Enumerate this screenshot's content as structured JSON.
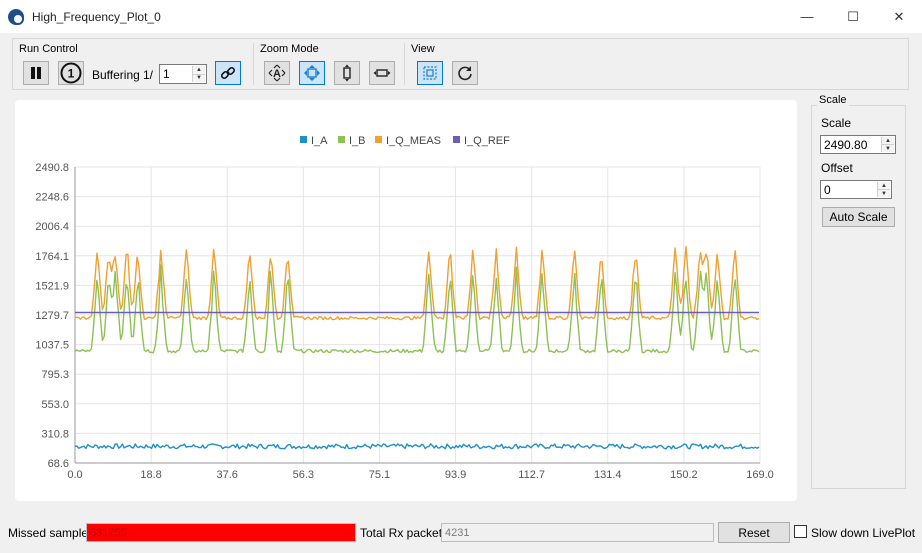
{
  "window": {
    "title": "High_Frequency_Plot_0",
    "minimize_glyph": "—",
    "maximize_glyph": "☐",
    "close_glyph": "✕"
  },
  "toolbar": {
    "run_control": {
      "title": "Run Control",
      "pause_icon": "pause-icon",
      "single_icon": "single-step-icon",
      "single_glyph": "1",
      "buffering_label": "Buffering",
      "buffering_prefix": "1/",
      "buffering_value": "1",
      "link_icon": "link-icon"
    },
    "zoom_mode": {
      "title": "Zoom Mode",
      "icons": [
        "zoom-all-icon",
        "zoom-xy-icon",
        "zoom-vertical-icon",
        "zoom-horizontal-icon"
      ]
    },
    "view": {
      "title": "View",
      "icons": [
        "fit-view-icon",
        "refresh-icon"
      ]
    }
  },
  "chart_data": {
    "type": "line",
    "legend_position": "top-center",
    "grid": true,
    "xlim": [
      0.0,
      169.0
    ],
    "ylim": [
      68.6,
      2490.8
    ],
    "x_ticks": [
      "0.0",
      "18.8",
      "37.6",
      "56.3",
      "75.1",
      "93.9",
      "112.7",
      "131.4",
      "150.2",
      "169.0"
    ],
    "y_ticks": [
      "2490.8",
      "2248.6",
      "2006.4",
      "1764.1",
      "1521.9",
      "1279.7",
      "1037.5",
      "795.3",
      "553.0",
      "310.8",
      "68.6"
    ],
    "spike_x": [
      5.5,
      8.3,
      10.0,
      12.8,
      15.5,
      21.2,
      27.5,
      34.3,
      43.1,
      48.3,
      52.5,
      87.3,
      92.5,
      98.2,
      103.9,
      108.9,
      115.3,
      123.2,
      129.8,
      138.3,
      148.1,
      150.7,
      154.2,
      155.8,
      158.5,
      162.8
    ],
    "series": [
      {
        "name": "I_A",
        "color": "#1f8ec9",
        "baseline": 205,
        "noise": 20
      },
      {
        "name": "I_B",
        "color": "#8dc153",
        "baseline": 985,
        "noise": 14,
        "spike_peak": 1660
      },
      {
        "name": "I_Q_MEAS",
        "color": "#f0a030",
        "baseline": 1255,
        "noise": 13,
        "spike_peak": 1850
      },
      {
        "name": "I_Q_REF",
        "color": "#6a5fb4",
        "baseline": 1300,
        "noise": 0
      }
    ]
  },
  "scale_panel": {
    "title": "Scale",
    "scale_label": "Scale",
    "scale_value": "2490.80",
    "offset_label": "Offset",
    "offset_value": "0",
    "auto_scale_label": "Auto Scale"
  },
  "status": {
    "missed_label": "Missed samples",
    "missed_value": "631755",
    "total_label": "Total Rx packets",
    "total_value": "4231",
    "reset_label": "Reset",
    "slow_label": "Slow down LivePlot"
  }
}
